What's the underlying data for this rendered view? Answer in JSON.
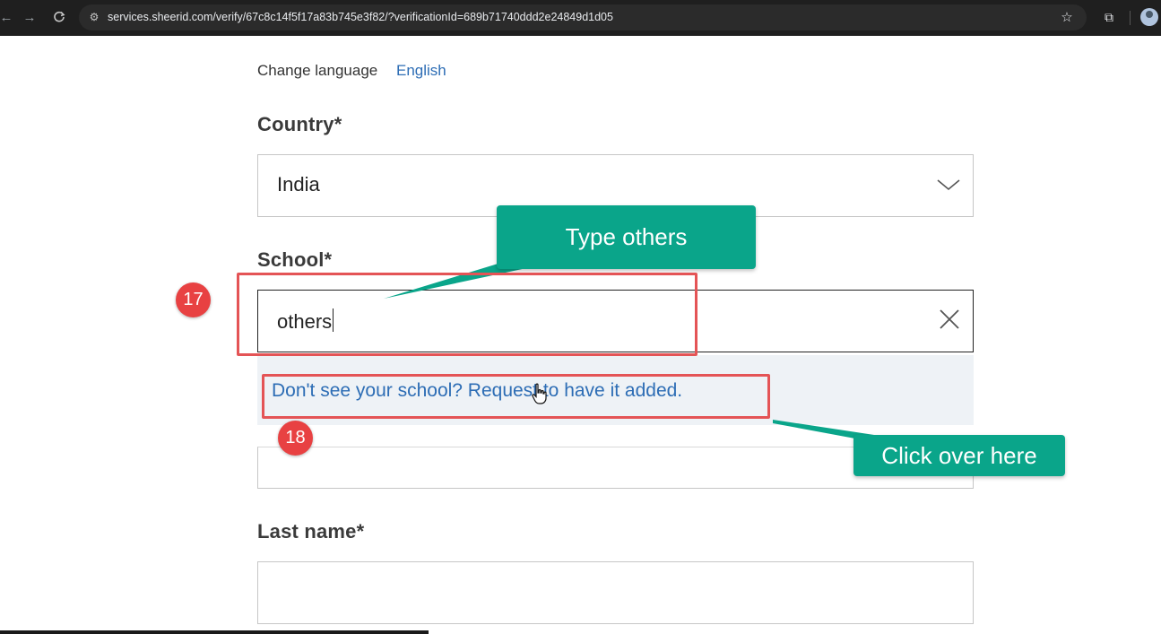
{
  "browser": {
    "url": "services.sheerid.com/verify/67c8c14f5f17a83b745e3f82/?verificationId=689b71740ddd2e24849d1d05",
    "icons": [
      "back-icon",
      "forward-icon",
      "reload-icon",
      "site-settings-icon",
      "star-icon",
      "extensions-icon",
      "profile-avatar"
    ]
  },
  "form": {
    "change_language_label": "Change language",
    "language_value": "English",
    "country": {
      "label": "Country*",
      "value": "India"
    },
    "school": {
      "label": "School*",
      "value": "others"
    },
    "suggestion_link": "Don't see your school? Request to have it added.",
    "last_name": {
      "label": "Last name*",
      "value": ""
    }
  },
  "annotations": {
    "callout_type": "Type others",
    "callout_click": "Click over here",
    "step_17": "17",
    "step_18": "18"
  },
  "colors": {
    "accent_link": "#2d6db5",
    "callout": "#0aa58a",
    "highlight": "#e45456",
    "badge": "#e84142"
  }
}
